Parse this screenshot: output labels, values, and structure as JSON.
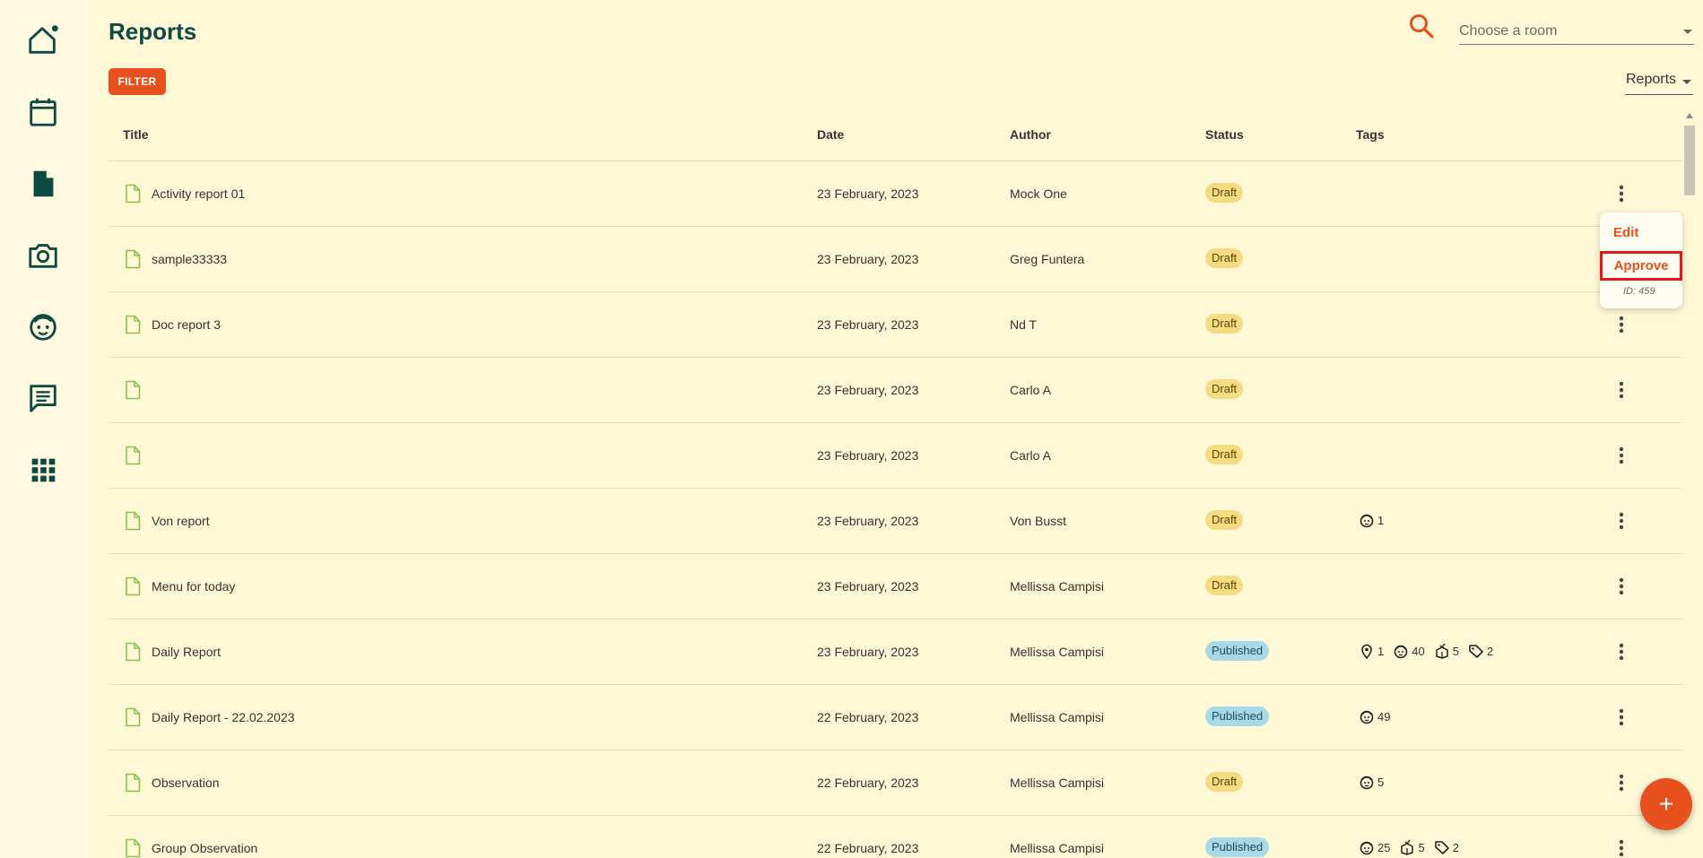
{
  "nav": [
    {
      "icon": "home-icon"
    },
    {
      "icon": "calendar-icon"
    },
    {
      "icon": "document-icon"
    },
    {
      "icon": "camera-icon"
    },
    {
      "icon": "child-face-icon"
    },
    {
      "icon": "chat-icon"
    },
    {
      "icon": "apps-grid-icon"
    }
  ],
  "header": {
    "title": "Reports",
    "room_placeholder": "Choose a room",
    "filter_label": "FILTER",
    "type_selected": "Reports"
  },
  "table": {
    "columns": [
      "Title",
      "Date",
      "Author",
      "Status",
      "Tags"
    ],
    "rows": [
      {
        "title": "Activity report 01",
        "date": "23 February, 2023",
        "author": "Mock One",
        "status": "Draft",
        "tags": []
      },
      {
        "title": "sample33333",
        "date": "23 February, 2023",
        "author": "Greg Funtera",
        "status": "Draft",
        "tags": []
      },
      {
        "title": "Doc report 3",
        "date": "23 February, 2023",
        "author": "Nd T",
        "status": "Draft",
        "tags": []
      },
      {
        "title": "",
        "date": "23 February, 2023",
        "author": "Carlo A",
        "status": "Draft",
        "tags": []
      },
      {
        "title": "",
        "date": "23 February, 2023",
        "author": "Carlo A",
        "status": "Draft",
        "tags": []
      },
      {
        "title": "Von report",
        "date": "23 February, 2023",
        "author": "Von Busst",
        "status": "Draft",
        "tags": [
          {
            "icon": "child-face-icon",
            "count": "1"
          }
        ]
      },
      {
        "title": "Menu for today",
        "date": "23 February, 2023",
        "author": "Mellissa Campisi",
        "status": "Draft",
        "tags": []
      },
      {
        "title": "Daily Report",
        "date": "23 February, 2023",
        "author": "Mellissa Campisi",
        "status": "Published",
        "tags": [
          {
            "icon": "location-pin-icon",
            "count": "1"
          },
          {
            "icon": "child-face-icon",
            "count": "40"
          },
          {
            "icon": "learning-outcome-icon",
            "count": "5"
          },
          {
            "icon": "tag-icon",
            "count": "2"
          }
        ]
      },
      {
        "title": "Daily Report - 22.02.2023",
        "date": "22 February, 2023",
        "author": "Mellissa Campisi",
        "status": "Published",
        "tags": [
          {
            "icon": "child-face-icon",
            "count": "49"
          }
        ]
      },
      {
        "title": "Observation",
        "date": "22 February, 2023",
        "author": "Mellissa Campisi",
        "status": "Draft",
        "tags": [
          {
            "icon": "child-face-icon",
            "count": "5"
          }
        ]
      },
      {
        "title": "Group Observation",
        "date": "22 February, 2023",
        "author": "Mellissa Campisi",
        "status": "Published",
        "tags": [
          {
            "icon": "child-face-icon",
            "count": "25"
          },
          {
            "icon": "learning-outcome-icon",
            "count": "5"
          },
          {
            "icon": "tag-icon",
            "count": "2"
          }
        ]
      }
    ]
  },
  "context_menu": {
    "edit_label": "Edit",
    "approve_label": "Approve",
    "id_label": "ID: 459"
  },
  "fab": {
    "label": "+"
  },
  "colors": {
    "background": "#fff8d6",
    "primary_dark": "#0d4a43",
    "accent": "#e8501e",
    "draft": "#f5dc82",
    "published": "#a8d9e6",
    "doc_icon": "#8bc34a"
  }
}
